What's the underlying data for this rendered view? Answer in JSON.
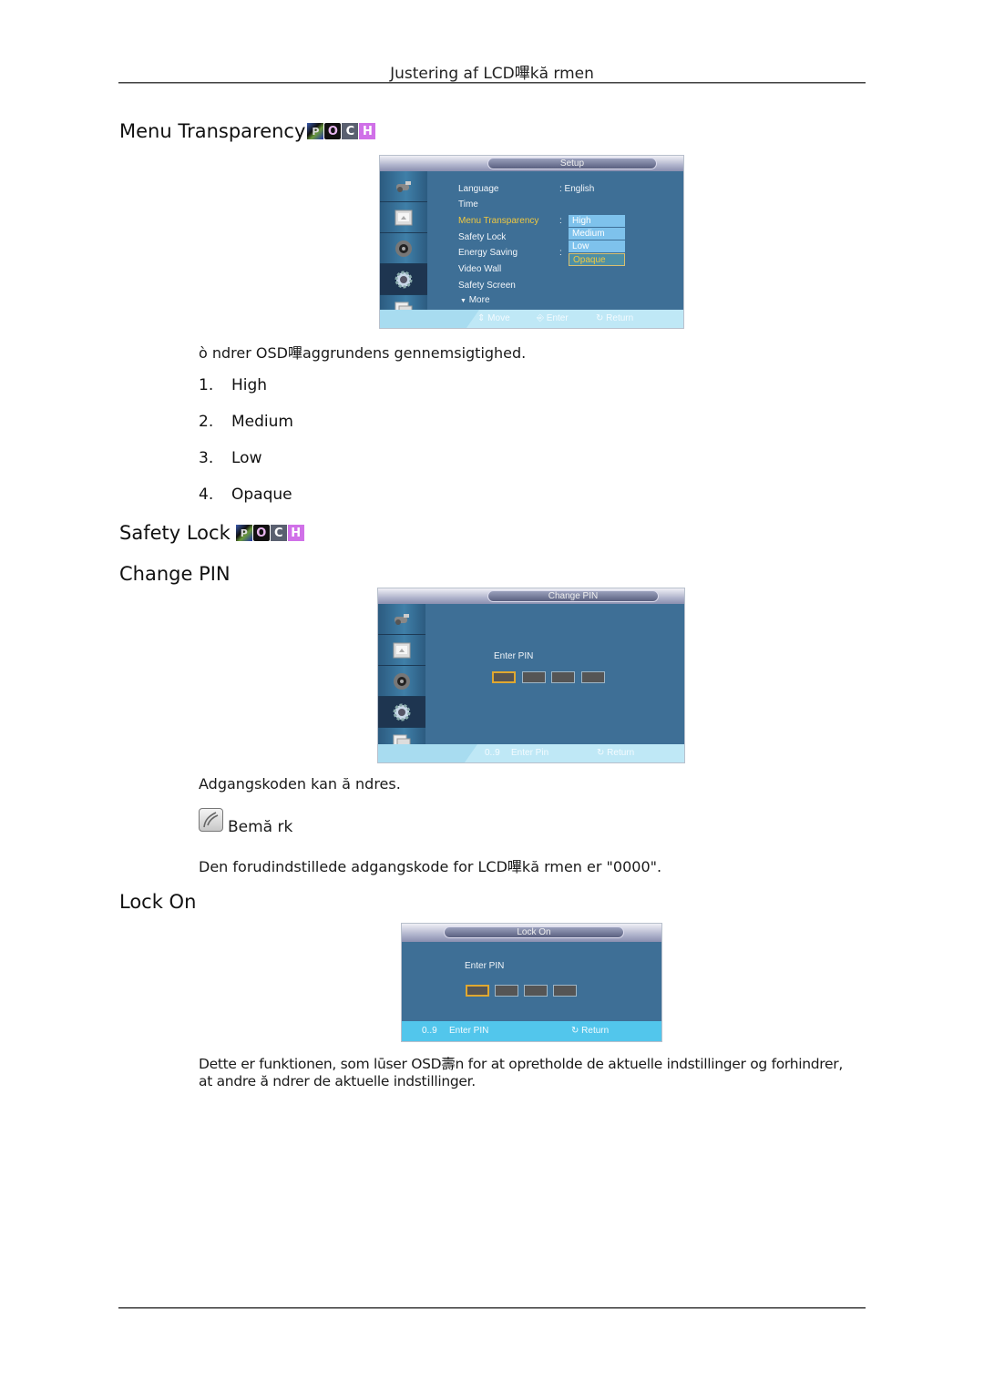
{
  "header": {
    "title": "Justering af LCD嗶kă rmen"
  },
  "sections": {
    "menu_transparency": {
      "heading": "Menu Transparency",
      "badges": [
        "P",
        "O",
        "C",
        "H"
      ],
      "osd": {
        "title": "Setup",
        "items": [
          {
            "label": "Language",
            "value": ": English"
          },
          {
            "label": "Time"
          },
          {
            "label": "Menu Transparency",
            "value": ":",
            "highlighted": true
          },
          {
            "label": "Safety Lock"
          },
          {
            "label": "Energy Saving",
            "value": ":"
          },
          {
            "label": "Video Wall"
          },
          {
            "label": "Safety Screen"
          },
          {
            "label": "More"
          }
        ],
        "dropdown": [
          "High",
          "Medium",
          "Low",
          "Opaque"
        ],
        "dropdown_selected": "Opaque",
        "footer": {
          "move": "Move",
          "enter": "Enter",
          "return": "Return"
        }
      },
      "description": "ò ndrer OSD嗶aggrundens gennemsigtighed.",
      "options": [
        {
          "num": "1.",
          "label": "High"
        },
        {
          "num": "2.",
          "label": "Medium"
        },
        {
          "num": "3.",
          "label": "Low"
        },
        {
          "num": "4.",
          "label": "Opaque"
        }
      ]
    },
    "safety_lock": {
      "heading": "Safety Lock",
      "badges": [
        "P",
        "O",
        "C",
        "H"
      ]
    },
    "change_pin": {
      "heading": "Change PIN",
      "osd": {
        "title": "Change PIN",
        "label": "Enter PIN",
        "footer": {
          "digits": "0..9",
          "enter": "Enter Pin",
          "return": "Return"
        }
      },
      "description": "Adgangskoden kan ă ndres.",
      "note_title": "Bemă rk",
      "note_text": "Den forudindstillede adgangskode for LCD嗶kă rmen er \"0000\"."
    },
    "lock_on": {
      "heading": "Lock On",
      "osd": {
        "title": "Lock On",
        "label": "Enter PIN",
        "footer": {
          "digits": "0..9",
          "enter": "Enter PIN",
          "return": "Return"
        }
      },
      "description_line1": "Dette er funktionen, som lūser OSD壽n for at opretholde de aktuelle indstillinger og forhindrer,",
      "description_line2": "at andre ă ndrer de aktuelle indstillinger."
    }
  }
}
